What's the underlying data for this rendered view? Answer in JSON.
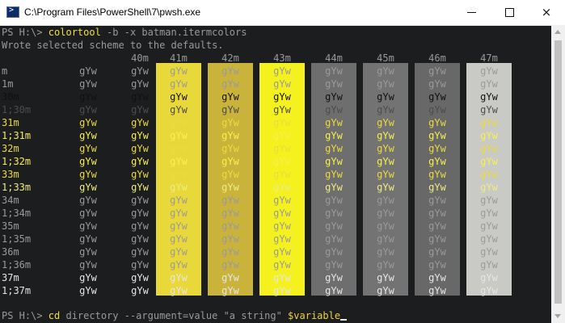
{
  "window": {
    "title": "C:\\Program Files\\PowerShell\\7\\pwsh.exe",
    "icon": "powershell-icon",
    "controls": {
      "minimize": "minimize-icon",
      "maximize": "maximize-icon",
      "close": "×"
    }
  },
  "terminal": {
    "line1": {
      "prompt": "PS H:\\> ",
      "command": "colortool",
      "args": " -b -x batman.itermcolors"
    },
    "line2": "Wrote selected scheme to the defaults.",
    "sample_text": "gYw",
    "column_headers": [
      "40m",
      "41m",
      "42m",
      "43m",
      "44m",
      "45m",
      "46m",
      "47m"
    ],
    "row_labels": [
      "m",
      "1m",
      "30m",
      "1;30m",
      "31m",
      "1;31m",
      "32m",
      "1;32m",
      "33m",
      "1;33m",
      "34m",
      "1;34m",
      "35m",
      "1;35m",
      "36m",
      "1;36m",
      "37m",
      "1;37m"
    ],
    "last_line": {
      "prompt": "PS H:\\> ",
      "command": "cd",
      "arg1": " directory ",
      "arg2": "--argument=value ",
      "string": "\"a string\" ",
      "variable": "$variable"
    }
  },
  "colors": {
    "background": "#1c1d1f",
    "band_41m": "#e9d83a",
    "band_42m": "#c9b33b",
    "band_43m": "#f4f11e",
    "band_44m": "#6e6e6e",
    "band_45m": "#737373",
    "band_46m": "#686868",
    "band_47m": "#c9c9c5",
    "command_yellow": "#f0e040",
    "variable_yellow": "#f0d040",
    "gray_text": "#9a9a9a",
    "white_text": "#e6e6e6",
    "black_text": "#101010",
    "dim_text": "#4d4d4d",
    "yellow_text": "#ebdc3a",
    "bright_yellow_text": "#faf04a",
    "pale_yellow_text": "#eeec80"
  }
}
